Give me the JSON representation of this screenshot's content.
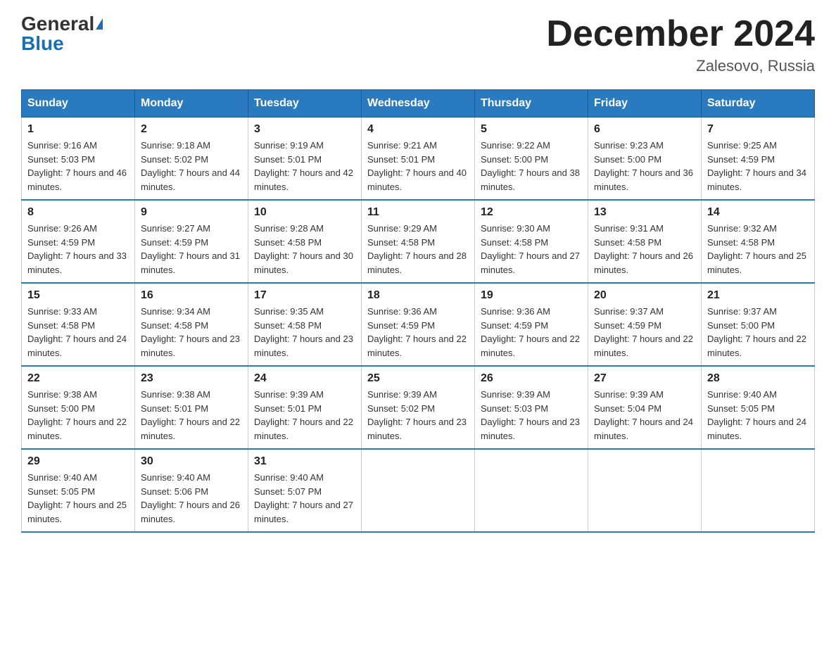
{
  "header": {
    "logo_general": "General",
    "logo_blue": "Blue",
    "month_title": "December 2024",
    "location": "Zalesovo, Russia"
  },
  "days_of_week": [
    "Sunday",
    "Monday",
    "Tuesday",
    "Wednesday",
    "Thursday",
    "Friday",
    "Saturday"
  ],
  "weeks": [
    [
      {
        "day": "1",
        "sunrise": "Sunrise: 9:16 AM",
        "sunset": "Sunset: 5:03 PM",
        "daylight": "Daylight: 7 hours and 46 minutes."
      },
      {
        "day": "2",
        "sunrise": "Sunrise: 9:18 AM",
        "sunset": "Sunset: 5:02 PM",
        "daylight": "Daylight: 7 hours and 44 minutes."
      },
      {
        "day": "3",
        "sunrise": "Sunrise: 9:19 AM",
        "sunset": "Sunset: 5:01 PM",
        "daylight": "Daylight: 7 hours and 42 minutes."
      },
      {
        "day": "4",
        "sunrise": "Sunrise: 9:21 AM",
        "sunset": "Sunset: 5:01 PM",
        "daylight": "Daylight: 7 hours and 40 minutes."
      },
      {
        "day": "5",
        "sunrise": "Sunrise: 9:22 AM",
        "sunset": "Sunset: 5:00 PM",
        "daylight": "Daylight: 7 hours and 38 minutes."
      },
      {
        "day": "6",
        "sunrise": "Sunrise: 9:23 AM",
        "sunset": "Sunset: 5:00 PM",
        "daylight": "Daylight: 7 hours and 36 minutes."
      },
      {
        "day": "7",
        "sunrise": "Sunrise: 9:25 AM",
        "sunset": "Sunset: 4:59 PM",
        "daylight": "Daylight: 7 hours and 34 minutes."
      }
    ],
    [
      {
        "day": "8",
        "sunrise": "Sunrise: 9:26 AM",
        "sunset": "Sunset: 4:59 PM",
        "daylight": "Daylight: 7 hours and 33 minutes."
      },
      {
        "day": "9",
        "sunrise": "Sunrise: 9:27 AM",
        "sunset": "Sunset: 4:59 PM",
        "daylight": "Daylight: 7 hours and 31 minutes."
      },
      {
        "day": "10",
        "sunrise": "Sunrise: 9:28 AM",
        "sunset": "Sunset: 4:58 PM",
        "daylight": "Daylight: 7 hours and 30 minutes."
      },
      {
        "day": "11",
        "sunrise": "Sunrise: 9:29 AM",
        "sunset": "Sunset: 4:58 PM",
        "daylight": "Daylight: 7 hours and 28 minutes."
      },
      {
        "day": "12",
        "sunrise": "Sunrise: 9:30 AM",
        "sunset": "Sunset: 4:58 PM",
        "daylight": "Daylight: 7 hours and 27 minutes."
      },
      {
        "day": "13",
        "sunrise": "Sunrise: 9:31 AM",
        "sunset": "Sunset: 4:58 PM",
        "daylight": "Daylight: 7 hours and 26 minutes."
      },
      {
        "day": "14",
        "sunrise": "Sunrise: 9:32 AM",
        "sunset": "Sunset: 4:58 PM",
        "daylight": "Daylight: 7 hours and 25 minutes."
      }
    ],
    [
      {
        "day": "15",
        "sunrise": "Sunrise: 9:33 AM",
        "sunset": "Sunset: 4:58 PM",
        "daylight": "Daylight: 7 hours and 24 minutes."
      },
      {
        "day": "16",
        "sunrise": "Sunrise: 9:34 AM",
        "sunset": "Sunset: 4:58 PM",
        "daylight": "Daylight: 7 hours and 23 minutes."
      },
      {
        "day": "17",
        "sunrise": "Sunrise: 9:35 AM",
        "sunset": "Sunset: 4:58 PM",
        "daylight": "Daylight: 7 hours and 23 minutes."
      },
      {
        "day": "18",
        "sunrise": "Sunrise: 9:36 AM",
        "sunset": "Sunset: 4:59 PM",
        "daylight": "Daylight: 7 hours and 22 minutes."
      },
      {
        "day": "19",
        "sunrise": "Sunrise: 9:36 AM",
        "sunset": "Sunset: 4:59 PM",
        "daylight": "Daylight: 7 hours and 22 minutes."
      },
      {
        "day": "20",
        "sunrise": "Sunrise: 9:37 AM",
        "sunset": "Sunset: 4:59 PM",
        "daylight": "Daylight: 7 hours and 22 minutes."
      },
      {
        "day": "21",
        "sunrise": "Sunrise: 9:37 AM",
        "sunset": "Sunset: 5:00 PM",
        "daylight": "Daylight: 7 hours and 22 minutes."
      }
    ],
    [
      {
        "day": "22",
        "sunrise": "Sunrise: 9:38 AM",
        "sunset": "Sunset: 5:00 PM",
        "daylight": "Daylight: 7 hours and 22 minutes."
      },
      {
        "day": "23",
        "sunrise": "Sunrise: 9:38 AM",
        "sunset": "Sunset: 5:01 PM",
        "daylight": "Daylight: 7 hours and 22 minutes."
      },
      {
        "day": "24",
        "sunrise": "Sunrise: 9:39 AM",
        "sunset": "Sunset: 5:01 PM",
        "daylight": "Daylight: 7 hours and 22 minutes."
      },
      {
        "day": "25",
        "sunrise": "Sunrise: 9:39 AM",
        "sunset": "Sunset: 5:02 PM",
        "daylight": "Daylight: 7 hours and 23 minutes."
      },
      {
        "day": "26",
        "sunrise": "Sunrise: 9:39 AM",
        "sunset": "Sunset: 5:03 PM",
        "daylight": "Daylight: 7 hours and 23 minutes."
      },
      {
        "day": "27",
        "sunrise": "Sunrise: 9:39 AM",
        "sunset": "Sunset: 5:04 PM",
        "daylight": "Daylight: 7 hours and 24 minutes."
      },
      {
        "day": "28",
        "sunrise": "Sunrise: 9:40 AM",
        "sunset": "Sunset: 5:05 PM",
        "daylight": "Daylight: 7 hours and 24 minutes."
      }
    ],
    [
      {
        "day": "29",
        "sunrise": "Sunrise: 9:40 AM",
        "sunset": "Sunset: 5:05 PM",
        "daylight": "Daylight: 7 hours and 25 minutes."
      },
      {
        "day": "30",
        "sunrise": "Sunrise: 9:40 AM",
        "sunset": "Sunset: 5:06 PM",
        "daylight": "Daylight: 7 hours and 26 minutes."
      },
      {
        "day": "31",
        "sunrise": "Sunrise: 9:40 AM",
        "sunset": "Sunset: 5:07 PM",
        "daylight": "Daylight: 7 hours and 27 minutes."
      },
      null,
      null,
      null,
      null
    ]
  ]
}
